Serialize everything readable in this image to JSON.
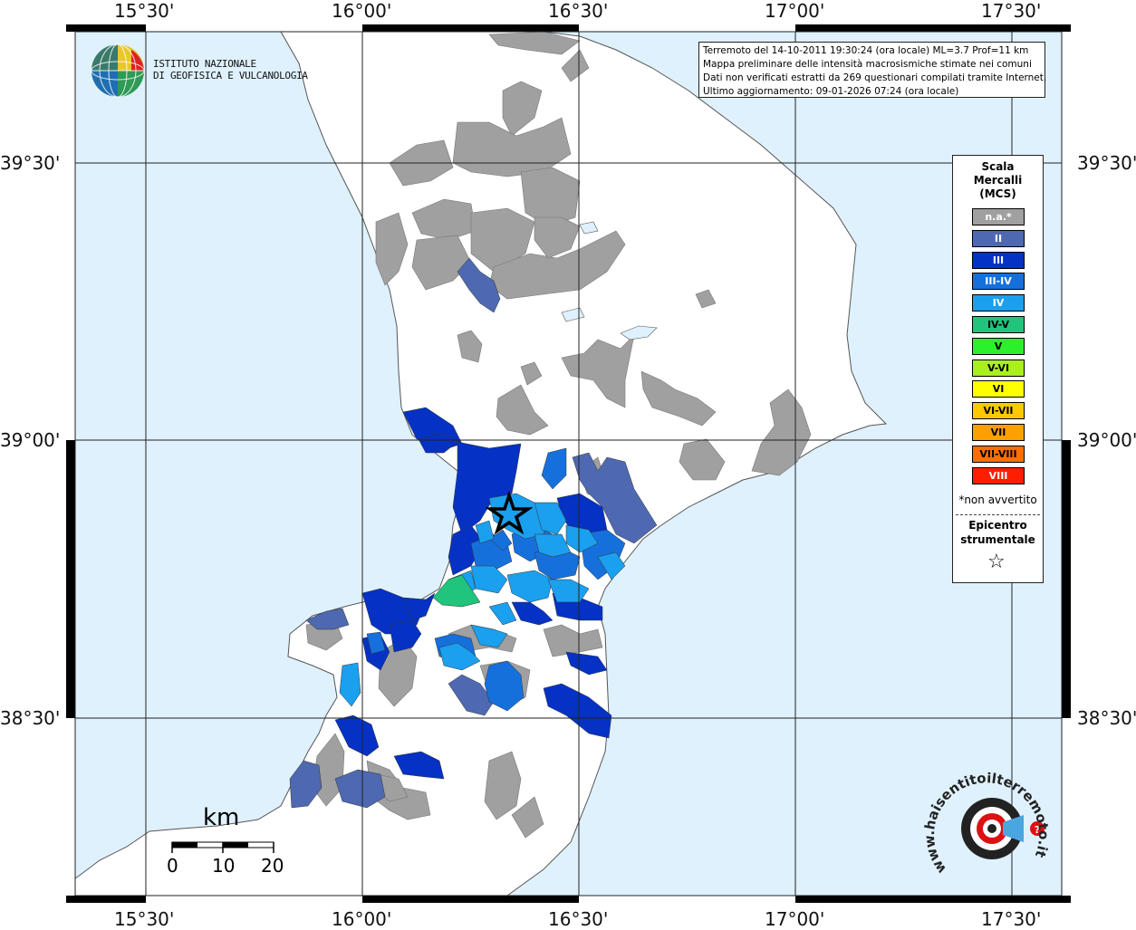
{
  "map": {
    "lon_labels": [
      "15°30'",
      "16°00'",
      "16°30'",
      "17°00'",
      "17°30'"
    ],
    "lat_labels": [
      "39°30'",
      "39°00'",
      "38°30'"
    ],
    "colors": {
      "sea": "#dff1fd",
      "land": "#ffffff",
      "na": "#a0a0a0",
      "II": "#4e69b1",
      "III": "#0532c4",
      "III-IV": "#1670dc",
      "IV": "#1aa0ee",
      "IV-V": "#20c47c"
    }
  },
  "info": {
    "line1": "Terremoto del 14-10-2011 19:30:24 (ora locale) ML=3.7 Prof=11 km",
    "line2": "Mappa preliminare delle intensità macrosismiche stimate nei comuni",
    "line3": "Dati non verificati estratti da 269 questionari compilati tramite Internet.",
    "line4": "Ultimo aggiornamento: 09-01-2026 07:24 (ora locale)"
  },
  "logo": {
    "line1": "ISTITUTO NAZIONALE",
    "line2": "DI GEOFISICA E VULCANOLOGIA",
    "site_text": "www.haisentitoilterremoto.it"
  },
  "legend": {
    "title_line1": "Scala",
    "title_line2": "Mercalli",
    "title_line3": "(MCS)",
    "items": [
      {
        "label": "n.a.*",
        "color": "#a0a0a0",
        "text_color": "#ffffff"
      },
      {
        "label": "II",
        "color": "#4e69b1",
        "text_color": "#ffffff"
      },
      {
        "label": "III",
        "color": "#0532c4",
        "text_color": "#ffffff"
      },
      {
        "label": "III-IV",
        "color": "#1670dc",
        "text_color": "#ffffff"
      },
      {
        "label": "IV",
        "color": "#1aa0ee",
        "text_color": "#ffffff"
      },
      {
        "label": "IV-V",
        "color": "#20c47c",
        "text_color": "#000000"
      },
      {
        "label": "V",
        "color": "#2df02d",
        "text_color": "#000000"
      },
      {
        "label": "V-VI",
        "color": "#aaf01e",
        "text_color": "#000000"
      },
      {
        "label": "VI",
        "color": "#ffff00",
        "text_color": "#000000"
      },
      {
        "label": "VI-VII",
        "color": "#ffc800",
        "text_color": "#000000"
      },
      {
        "label": "VII",
        "color": "#ffa000",
        "text_color": "#000000"
      },
      {
        "label": "VII-VIII",
        "color": "#ff6e00",
        "text_color": "#000000"
      },
      {
        "label": "VIII",
        "color": "#ff1e00",
        "text_color": "#ffffff"
      }
    ],
    "note": "*non avvertito",
    "epicenter_line1": "Epicentro",
    "epicenter_line2": "strumentale",
    "epicenter_icon": "star-outline-icon"
  },
  "scale_bar": {
    "unit": "km",
    "ticks": [
      "0",
      "10",
      "20"
    ]
  }
}
